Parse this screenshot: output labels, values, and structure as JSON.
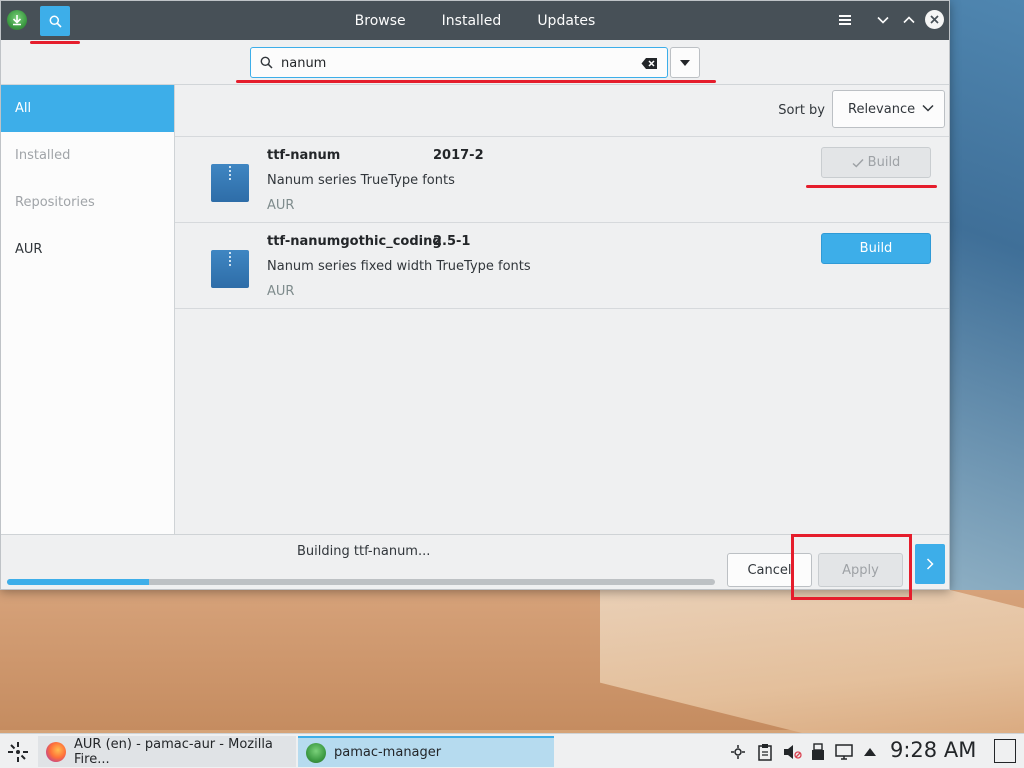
{
  "titlebar": {
    "tabs": [
      "Browse",
      "Installed",
      "Updates"
    ]
  },
  "search": {
    "value": "nanum",
    "placeholder": ""
  },
  "sidebar": {
    "items": [
      {
        "label": "All",
        "state": "active"
      },
      {
        "label": "Installed",
        "state": "dim"
      },
      {
        "label": "Repositories",
        "state": "dim"
      },
      {
        "label": "AUR",
        "state": "normal"
      }
    ]
  },
  "sort": {
    "label": "Sort by",
    "selected": "Relevance"
  },
  "packages": [
    {
      "name": "ttf-nanum",
      "version": "2017-2",
      "description": "Nanum series TrueType fonts",
      "repo": "AUR",
      "button": "Build",
      "button_state": "checked-disabled"
    },
    {
      "name": "ttf-nanumgothic_coding",
      "version": "2.5-1",
      "description": "Nanum series fixed width TrueType fonts",
      "repo": "AUR",
      "button": "Build",
      "button_state": "primary"
    }
  ],
  "bottom": {
    "status": "Building ttf-nanum...",
    "progress_fraction": 0.2,
    "cancel_label": "Cancel",
    "apply_label": "Apply"
  },
  "taskbar": {
    "tasks": [
      {
        "label": "AUR (en) - pamac-aur - Mozilla Fire...",
        "icon": "firefox-icon"
      },
      {
        "label": "pamac-manager",
        "icon": "pamac-icon"
      }
    ],
    "clock": "9:28 AM"
  },
  "colors": {
    "accent": "#3daee9",
    "annotation": "#e51d2c",
    "titlebar": "#475057"
  }
}
